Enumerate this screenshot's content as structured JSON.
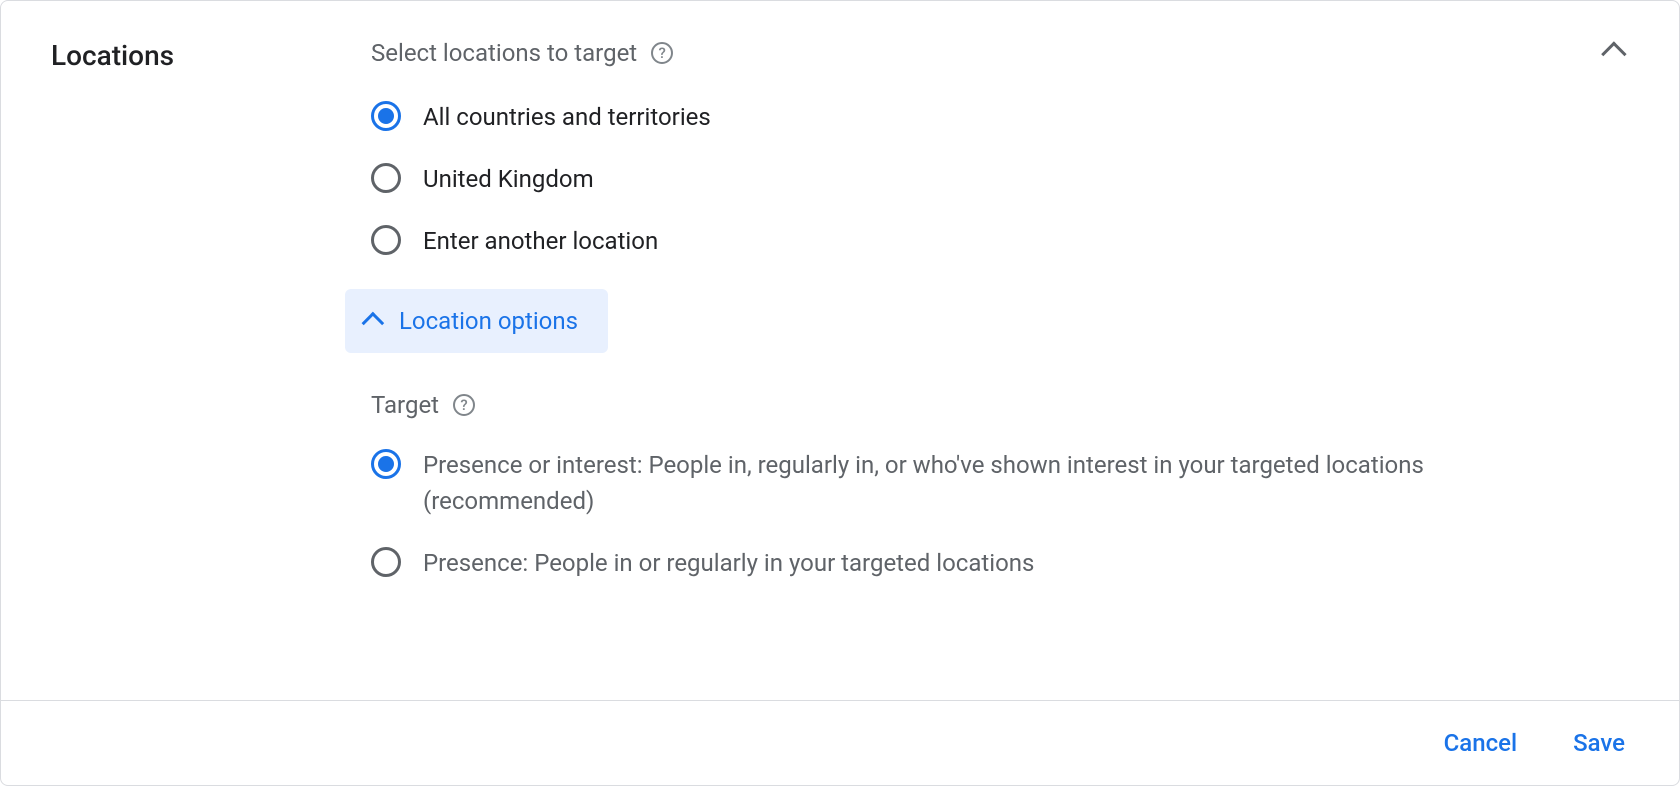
{
  "section": {
    "title": "Locations",
    "subtitle": "Select locations to target"
  },
  "locations": {
    "options": [
      {
        "label": "All countries and territories",
        "selected": true
      },
      {
        "label": "United Kingdom",
        "selected": false
      },
      {
        "label": "Enter another location",
        "selected": false
      }
    ]
  },
  "location_options": {
    "toggle_label": "Location options",
    "expanded": true
  },
  "target": {
    "label": "Target",
    "options": [
      {
        "label": "Presence or interest: People in, regularly in, or who've shown interest in your targeted locations (recommended)",
        "selected": true
      },
      {
        "label": "Presence: People in or regularly in your targeted locations",
        "selected": false
      }
    ]
  },
  "footer": {
    "cancel_label": "Cancel",
    "save_label": "Save"
  }
}
